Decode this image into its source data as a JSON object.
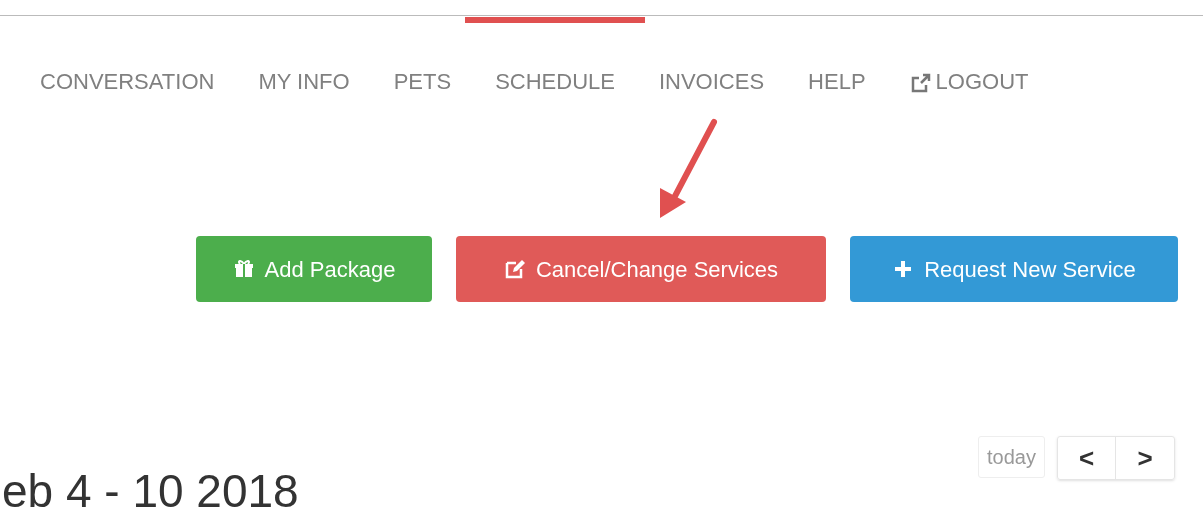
{
  "nav": {
    "items": [
      {
        "label": "CONVERSATION",
        "kind": "link",
        "selected": false
      },
      {
        "label": "MY INFO",
        "kind": "link",
        "selected": false
      },
      {
        "label": "PETS",
        "kind": "link",
        "selected": false
      },
      {
        "label": "SCHEDULE",
        "kind": "link",
        "selected": true
      },
      {
        "label": "INVOICES",
        "kind": "link",
        "selected": false
      },
      {
        "label": "HELP",
        "kind": "link",
        "selected": false
      },
      {
        "label": "LOGOUT",
        "kind": "logout",
        "selected": false
      }
    ]
  },
  "actions": [
    {
      "label": "Add Package",
      "kind": "package"
    },
    {
      "label": "Cancel/Change Services",
      "kind": "edit"
    },
    {
      "label": "Request New Service",
      "kind": "add"
    }
  ],
  "calendar": {
    "title": "eb 4 - 10 2018",
    "today": "today",
    "prev": "<",
    "next": ">"
  }
}
